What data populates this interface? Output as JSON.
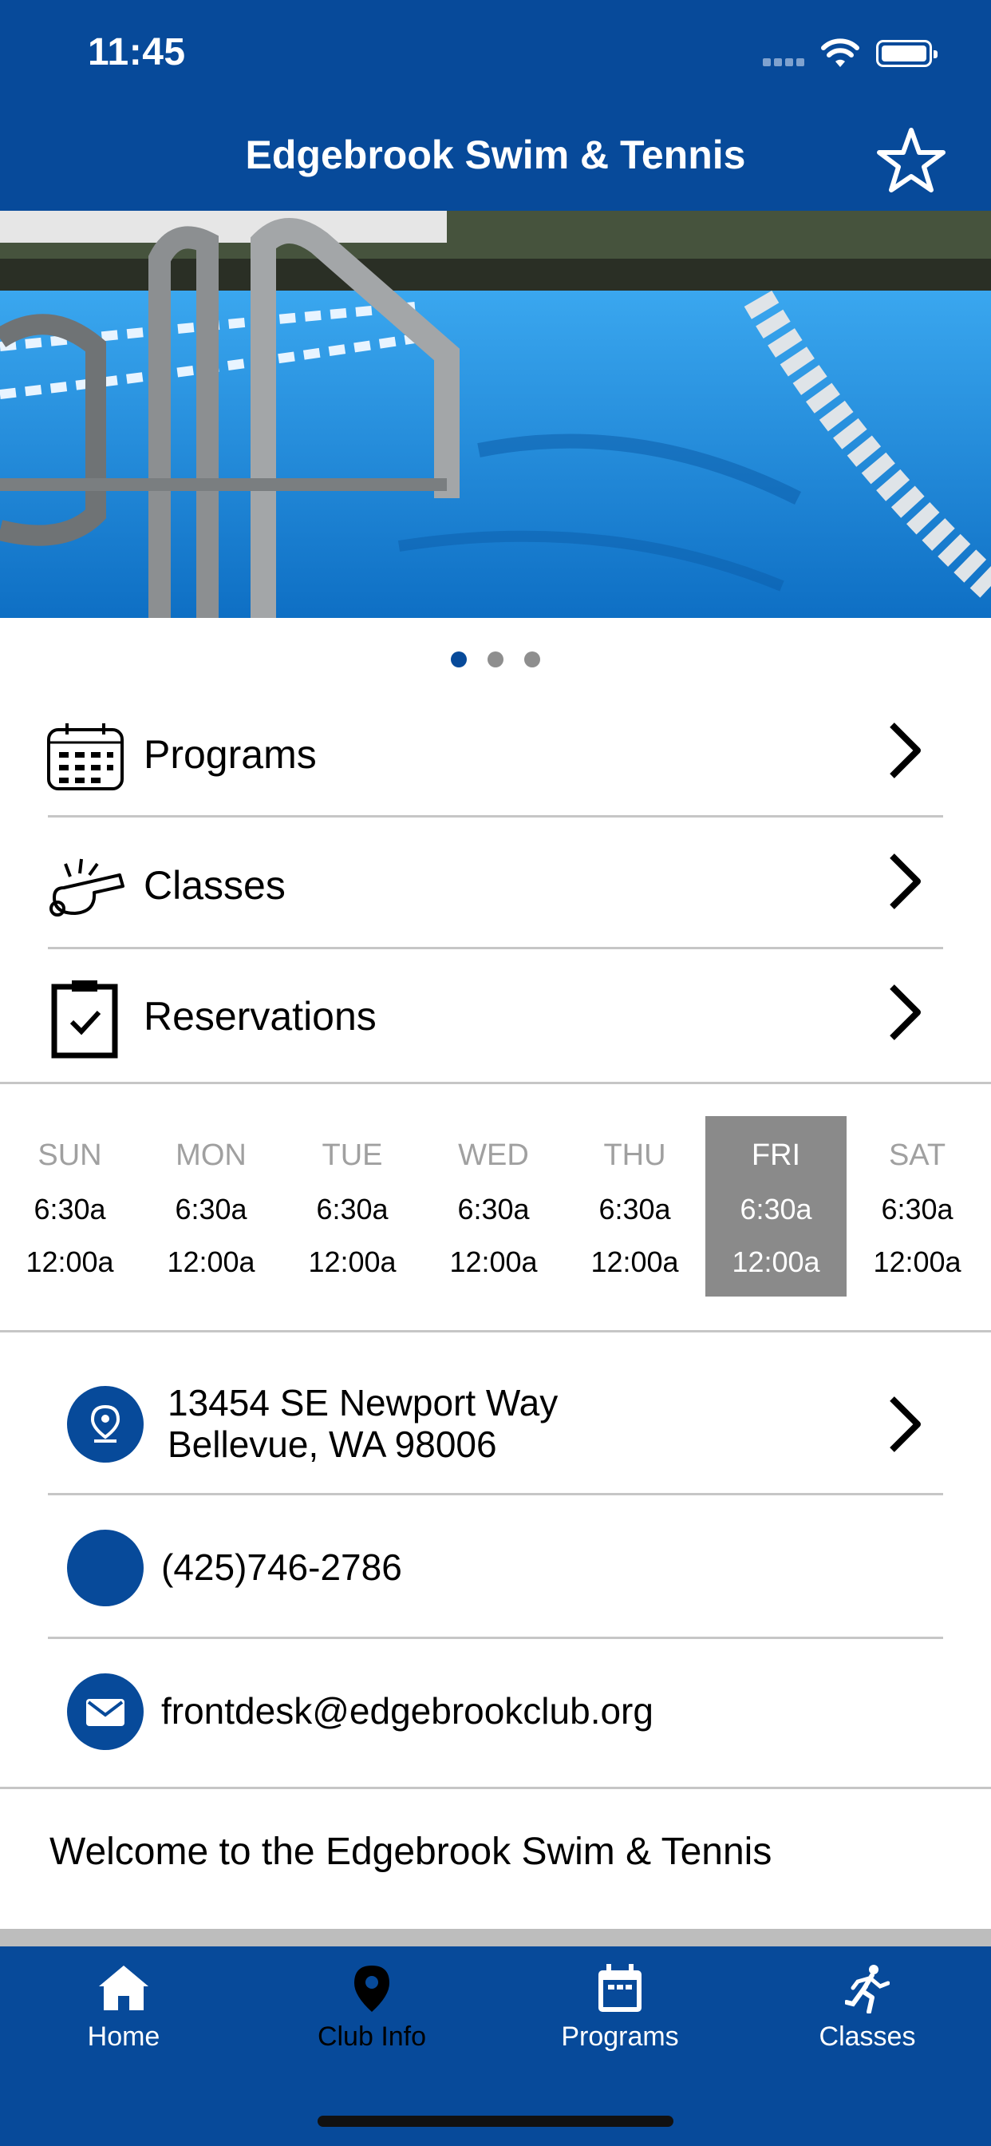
{
  "status_bar": {
    "time": "11:45"
  },
  "header": {
    "title": "Edgebrook Swim & Tennis",
    "favorite_icon": "star-outline-icon"
  },
  "carousel": {
    "page_count": 3,
    "active_index": 0
  },
  "nav_items": [
    {
      "label": "Programs",
      "icon": "calendar-icon"
    },
    {
      "label": "Classes",
      "icon": "whistle-icon"
    },
    {
      "label": "Reservations",
      "icon": "clipboard-check-icon"
    }
  ],
  "schedule": [
    {
      "day": "SUN",
      "open": "6:30a",
      "close": "12:00a",
      "active": false
    },
    {
      "day": "MON",
      "open": "6:30a",
      "close": "12:00a",
      "active": false
    },
    {
      "day": "TUE",
      "open": "6:30a",
      "close": "12:00a",
      "active": false
    },
    {
      "day": "WED",
      "open": "6:30a",
      "close": "12:00a",
      "active": false
    },
    {
      "day": "THU",
      "open": "6:30a",
      "close": "12:00a",
      "active": false
    },
    {
      "day": "FRI",
      "open": "6:30a",
      "close": "12:00a",
      "active": true
    },
    {
      "day": "SAT",
      "open": "6:30a",
      "close": "12:00a",
      "active": false
    }
  ],
  "contact": {
    "address_line1": "13454 SE Newport Way",
    "address_line2": "Bellevue, WA 98006",
    "phone": "(425)746-2786",
    "email": "frontdesk@edgebrookclub.org"
  },
  "welcome_text": "Welcome to the Edgebrook Swim & Tennis",
  "tab_bar": [
    {
      "label": "Home",
      "icon": "home-icon",
      "active": false
    },
    {
      "label": "Club Info",
      "icon": "map-pin-icon",
      "active": true
    },
    {
      "label": "Programs",
      "icon": "calendar-icon",
      "active": false
    },
    {
      "label": "Classes",
      "icon": "runner-icon",
      "active": false
    }
  ],
  "colors": {
    "brand": "#074a9a",
    "active_day": "#8a8a8a",
    "divider": "#c6c6c6"
  }
}
